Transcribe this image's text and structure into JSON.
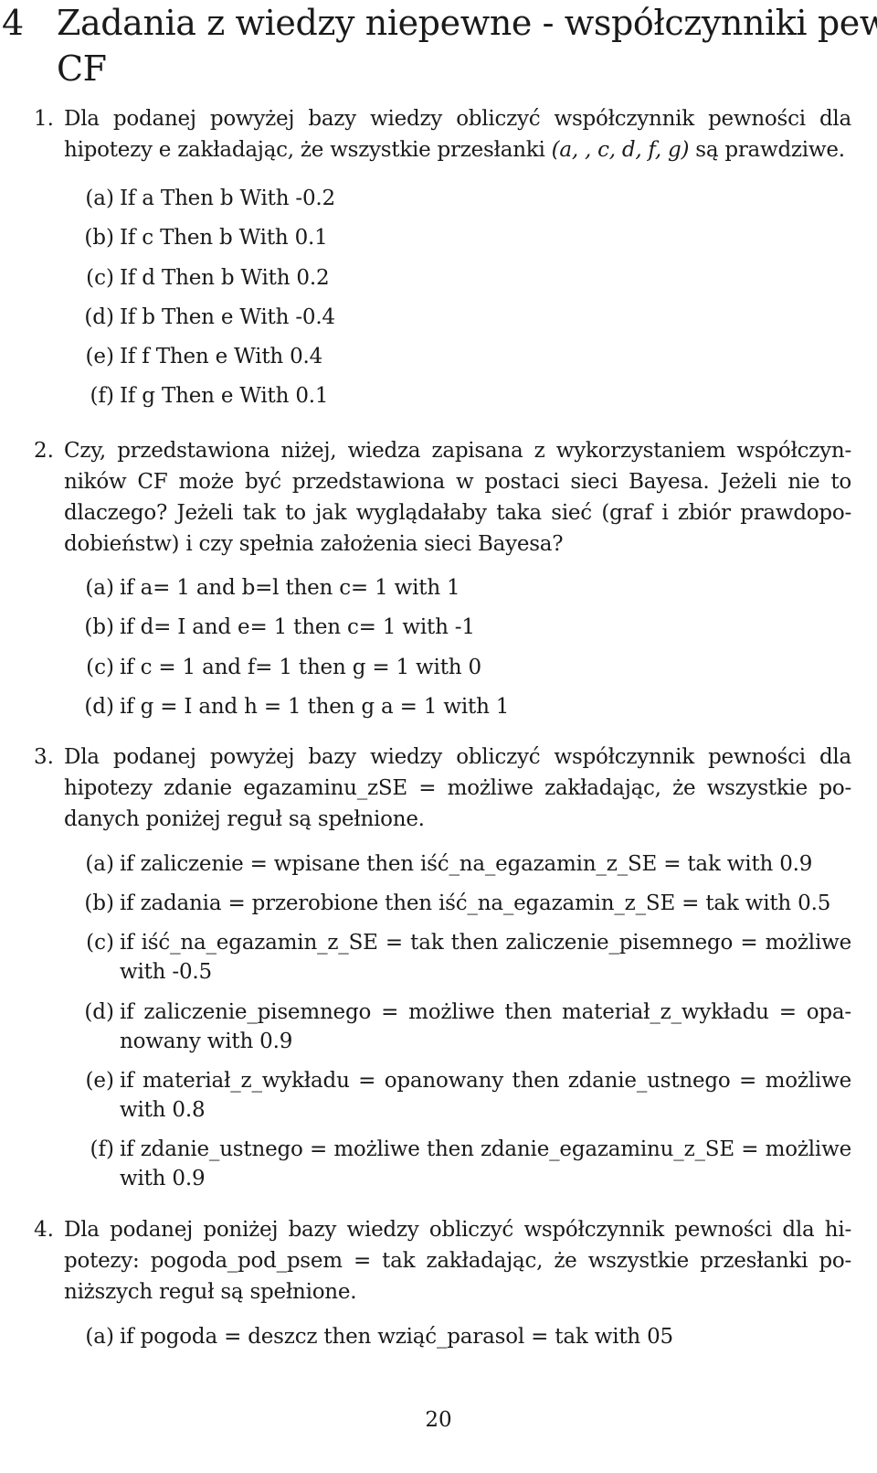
{
  "section": {
    "number": "4",
    "title": "Zadania z wiedzy niepewne - współczynniki pewności CF",
    "title_line1": "Zadania z wiedzy niepewne - współczynniki pewności",
    "title_line2": "CF"
  },
  "tasks": [
    {
      "number": "1.",
      "text_lines": [
        "Dla podanej powyżej bazy wiedzy obliczyć współczynnik pewności dla",
        "hipotezy e zakładając, że wszystkie przesłanki "
      ],
      "premises": "(a, , c, d, f, g)",
      "text_tail": " są prawdziwe.",
      "rules": [
        {
          "label": "(a)",
          "text": "If a Then b With -0.2"
        },
        {
          "label": "(b)",
          "text": "If c Then b With 0.1"
        },
        {
          "label": "(c)",
          "text": "If d Then b With 0.2"
        },
        {
          "label": "(d)",
          "text": "If b Then e With -0.4"
        },
        {
          "label": "(e)",
          "text": "If f Then e With 0.4"
        },
        {
          "label": "(f)",
          "text": "If g Then e With 0.1"
        }
      ]
    },
    {
      "number": "2.",
      "text_lines": [
        "Czy, przedstawiona niżej, wiedza zapisana z wykorzystaniem współczyn-",
        "ników CF może być przedstawiona w postaci sieci Bayesa. Jeżeli nie to",
        "dlaczego? Jeżeli tak to jak wyglądałaby taka sieć (graf i zbiór prawdopo-",
        "dobieństw) i czy spełnia założenia sieci Bayesa?"
      ],
      "rules": [
        {
          "label": "(a)",
          "text": "if a= 1 and b=l then c= 1 with 1"
        },
        {
          "label": "(b)",
          "text": "if d= I and e= 1 then c= 1 with -1"
        },
        {
          "label": "(c)",
          "text": "if c = 1 and f= 1 then g = 1 with 0"
        },
        {
          "label": "(d)",
          "text": "if g = I and h = 1 then g a = 1 with 1"
        }
      ]
    },
    {
      "number": "3.",
      "text_lines": [
        "Dla podanej powyżej bazy wiedzy obliczyć współczynnik pewności dla",
        "hipotezy zdanie egazaminu_zSE = możliwe zakładając, że wszystkie po-",
        "danych poniżej reguł są spełnione."
      ],
      "rules": [
        {
          "label": "(a)",
          "lines": [
            "if zaliczenie = wpisane then iść_na_egazamin_z_SE = tak with 0.9"
          ]
        },
        {
          "label": "(b)",
          "lines": [
            "if zadania = przerobione then iść_na_egazamin_z_SE = tak with 0.5"
          ]
        },
        {
          "label": "(c)",
          "lines": [
            "if iść_na_egazamin_z_SE = tak then zaliczenie_pisemnego = możliwe",
            "with -0.5"
          ]
        },
        {
          "label": "(d)",
          "lines": [
            "if zaliczenie_pisemnego = możliwe then materiał_z_wykładu = opa-",
            "nowany with 0.9"
          ]
        },
        {
          "label": "(e)",
          "lines": [
            "if materiał_z_wykładu = opanowany then zdanie_ustnego = możliwe",
            "with 0.8"
          ]
        },
        {
          "label": "(f)",
          "lines": [
            "if zdanie_ustnego = możliwe then zdanie_egazaminu_z_SE = możliwe",
            "with 0.9"
          ]
        }
      ]
    },
    {
      "number": "4.",
      "text_lines": [
        "Dla podanej poniżej bazy wiedzy obliczyć współczynnik pewności dla hi-",
        "potezy: pogoda_pod_psem = tak zakładając, że wszystkie przesłanki po-",
        "niższych reguł są spełnione."
      ],
      "rules": [
        {
          "label": "(a)",
          "lines": [
            "if pogoda = deszcz then wziąć_parasol = tak with 05"
          ]
        }
      ]
    }
  ],
  "footer": {
    "page_number": "20"
  }
}
